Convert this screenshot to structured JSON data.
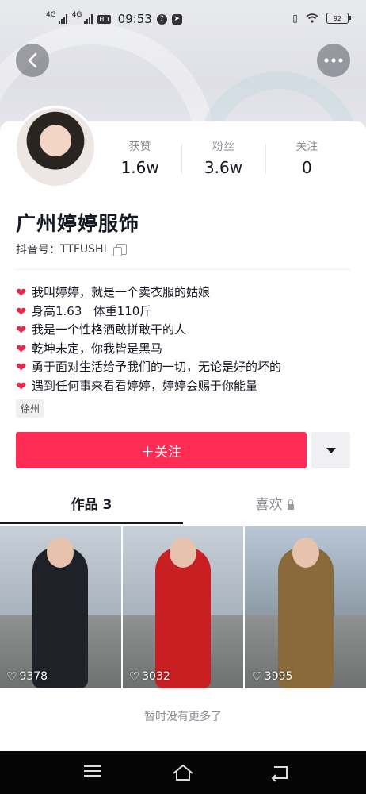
{
  "status_bar": {
    "network1": "4G",
    "network2": "4G",
    "hd": "HD",
    "time": "09:53",
    "battery": "92"
  },
  "header": {
    "back_icon": "chevron-left-icon",
    "more_icon": "ellipsis-icon"
  },
  "profile": {
    "name": "广州婷婷服饰",
    "douyin_id_label": "抖音号：",
    "douyin_id": "TTFUSHI",
    "stats": [
      {
        "label": "获赞",
        "value": "1.6w"
      },
      {
        "label": "粉丝",
        "value": "3.6w"
      },
      {
        "label": "关注",
        "value": "0"
      }
    ],
    "bio": [
      "我叫婷婷，就是一个卖衣服的姑娘",
      "身高1.63   体重110斤",
      "我是一个性格洒敢拼敢干的人",
      "乾坤未定，你我皆是黑马",
      "勇于面对生活给予我们的一切，无论是好的坏的",
      "遇到任何事来看看婷婷，婷婷会赐于你能量"
    ],
    "location_tag": "徐州"
  },
  "actions": {
    "follow_label": "＋关注"
  },
  "tabs": [
    {
      "label": "作品 3",
      "active": true
    },
    {
      "label": "喜欢",
      "active": false,
      "locked": true
    }
  ],
  "videos": [
    {
      "likes": "9378",
      "outfit_color": "#1f2128"
    },
    {
      "likes": "3032",
      "outfit_color": "#c81f23"
    },
    {
      "likes": "3995",
      "outfit_color": "#8a6a3a"
    }
  ],
  "footer": {
    "no_more": "暂时没有更多了"
  },
  "colors": {
    "accent": "#fe2c55",
    "text": "#161823",
    "muted": "#8a8b91"
  }
}
